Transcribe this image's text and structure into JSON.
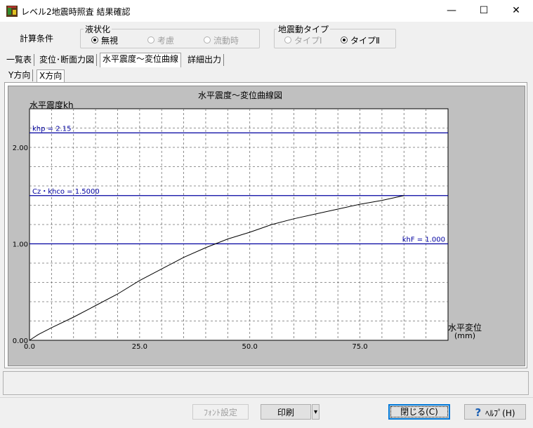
{
  "window": {
    "title": "レベル2地震時照査 結果確認",
    "minimize_glyph": "—",
    "maximize_glyph": "☐",
    "close_glyph": "✕"
  },
  "conditions": {
    "label": "計算条件",
    "liquefaction": {
      "title": "液状化",
      "options": [
        {
          "label": "無視",
          "selected": true,
          "enabled": true
        },
        {
          "label": "考慮",
          "selected": false,
          "enabled": false
        },
        {
          "label": "流動時",
          "selected": false,
          "enabled": false
        }
      ]
    },
    "motion_type": {
      "title": "地震動タイプ",
      "options": [
        {
          "label": "タイプⅠ",
          "selected": false,
          "enabled": false
        },
        {
          "label": "タイプⅡ",
          "selected": true,
          "enabled": true
        }
      ]
    }
  },
  "tabs": [
    {
      "label": "一覧表",
      "active": false
    },
    {
      "label": "変位･断面力図",
      "active": false
    },
    {
      "label": "水平震度～変位曲線",
      "active": true
    },
    {
      "label": "詳細出力",
      "active": false
    }
  ],
  "subtabs": [
    {
      "label": "Y方向",
      "active": false
    },
    {
      "label": "X方向",
      "active": true
    }
  ],
  "chart_data": {
    "type": "line",
    "title": "水平震度～変位曲線図",
    "ylabel": "水平震度kh",
    "xlabel": "水平変位",
    "xunit": "(mm)",
    "xlim": [
      0,
      95
    ],
    "ylim": [
      0,
      2.4
    ],
    "xticks": [
      0,
      25,
      50,
      75
    ],
    "xtick_labels": [
      "0.0",
      "25.0",
      "50.0",
      "75.0"
    ],
    "yticks": [
      0,
      1,
      2
    ],
    "ytick_labels": [
      "0.00",
      "1.00",
      "2.00"
    ],
    "grid": true,
    "hlines": [
      {
        "label": "khp = 2.15",
        "y": 2.15
      },
      {
        "label": "Cz・khco = 1.5000",
        "y": 1.5
      },
      {
        "label": "khF = 1.000",
        "y": 1.0
      }
    ],
    "series": [
      {
        "x": [
          0,
          2,
          5,
          10,
          15,
          20,
          25,
          30,
          35,
          40,
          45,
          50,
          55,
          60,
          65,
          70,
          75,
          80,
          85
        ],
        "y": [
          0,
          0.06,
          0.13,
          0.24,
          0.36,
          0.48,
          0.62,
          0.74,
          0.86,
          0.96,
          1.05,
          1.12,
          1.2,
          1.26,
          1.31,
          1.36,
          1.41,
          1.45,
          1.5
        ]
      }
    ]
  },
  "buttons": {
    "font_settings": "ﾌｫﾝﾄ設定",
    "print": "印刷",
    "print_dropdown": "▾",
    "close": "閉じる(C)",
    "help_icon": "?",
    "help": "ﾍﾙﾌﾟ(H)"
  },
  "colors": {
    "hline": "#0000a0",
    "curve": "#000000",
    "panel_bg": "#c0c0c0"
  }
}
